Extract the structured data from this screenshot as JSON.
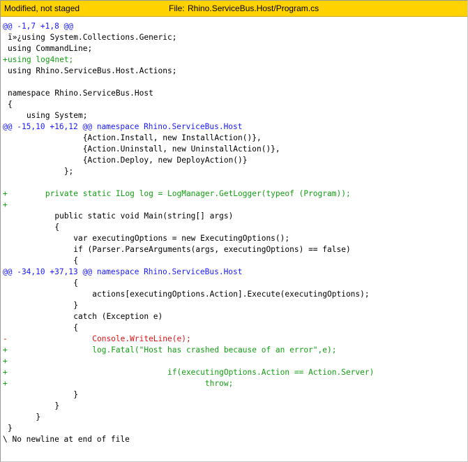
{
  "header": {
    "status": "Modified, not staged",
    "file_label": "File:",
    "file_path": "Rhino.ServiceBus.Host/Program.cs"
  },
  "colors": {
    "header_bg": "#ffd200",
    "added": "#12a012",
    "removed": "#e01212",
    "hunk": "#1a1aff",
    "context": "#000000"
  },
  "lines": [
    {
      "type": "hunk",
      "prefix": "",
      "text": "@@ -1,7 +1,8 @@"
    },
    {
      "type": "ctx",
      "prefix": " ",
      "text": "ï»¿using System.Collections.Generic;"
    },
    {
      "type": "ctx",
      "prefix": " ",
      "text": "using CommandLine;"
    },
    {
      "type": "add",
      "prefix": "+",
      "text": "using log4net;"
    },
    {
      "type": "ctx",
      "prefix": " ",
      "text": "using Rhino.ServiceBus.Host.Actions;"
    },
    {
      "type": "ctx",
      "prefix": " ",
      "text": ""
    },
    {
      "type": "ctx",
      "prefix": " ",
      "text": "namespace Rhino.ServiceBus.Host"
    },
    {
      "type": "ctx",
      "prefix": " ",
      "text": "{"
    },
    {
      "type": "ctx",
      "prefix": " ",
      "text": "    using System;"
    },
    {
      "type": "hunk",
      "prefix": "",
      "text": "@@ -15,10 +16,12 @@ namespace Rhino.ServiceBus.Host"
    },
    {
      "type": "ctx",
      "prefix": " ",
      "text": "                {Action.Install, new InstallAction()},"
    },
    {
      "type": "ctx",
      "prefix": " ",
      "text": "                {Action.Uninstall, new UninstallAction()},"
    },
    {
      "type": "ctx",
      "prefix": " ",
      "text": "                {Action.Deploy, new DeployAction()}"
    },
    {
      "type": "ctx",
      "prefix": " ",
      "text": "            };"
    },
    {
      "type": "ctx",
      "prefix": " ",
      "text": ""
    },
    {
      "type": "add",
      "prefix": "+",
      "text": "        private static ILog log = LogManager.GetLogger(typeof (Program));"
    },
    {
      "type": "add",
      "prefix": "+",
      "text": ""
    },
    {
      "type": "ctx",
      "prefix": " ",
      "text": "          public static void Main(string[] args)"
    },
    {
      "type": "ctx",
      "prefix": " ",
      "text": "          {"
    },
    {
      "type": "ctx",
      "prefix": " ",
      "text": "              var executingOptions = new ExecutingOptions();"
    },
    {
      "type": "ctx",
      "prefix": " ",
      "text": "              if (Parser.ParseArguments(args, executingOptions) == false)"
    },
    {
      "type": "ctx",
      "prefix": " ",
      "text": "              {"
    },
    {
      "type": "hunk",
      "prefix": "",
      "text": "@@ -34,10 +37,13 @@ namespace Rhino.ServiceBus.Host"
    },
    {
      "type": "ctx",
      "prefix": " ",
      "text": "              {"
    },
    {
      "type": "ctx",
      "prefix": " ",
      "text": "                  actions[executingOptions.Action].Execute(executingOptions);"
    },
    {
      "type": "ctx",
      "prefix": " ",
      "text": "              }"
    },
    {
      "type": "ctx",
      "prefix": " ",
      "text": "              catch (Exception e)"
    },
    {
      "type": "ctx",
      "prefix": " ",
      "text": "              {"
    },
    {
      "type": "del",
      "prefix": "-",
      "text": "                  Console.WriteLine(e);"
    },
    {
      "type": "add",
      "prefix": "+",
      "text": "                  log.Fatal(\"Host has crashed because of an error\",e);"
    },
    {
      "type": "add",
      "prefix": "+",
      "text": ""
    },
    {
      "type": "add",
      "prefix": "+",
      "text": "                                  if(executingOptions.Action == Action.Server)"
    },
    {
      "type": "add",
      "prefix": "+",
      "text": "                                          throw;"
    },
    {
      "type": "ctx",
      "prefix": " ",
      "text": "              }"
    },
    {
      "type": "ctx",
      "prefix": " ",
      "text": "          }"
    },
    {
      "type": "ctx",
      "prefix": " ",
      "text": "      }"
    },
    {
      "type": "ctx",
      "prefix": " ",
      "text": "}"
    },
    {
      "type": "ctx",
      "prefix": "",
      "text": "\\ No newline at end of file"
    }
  ]
}
